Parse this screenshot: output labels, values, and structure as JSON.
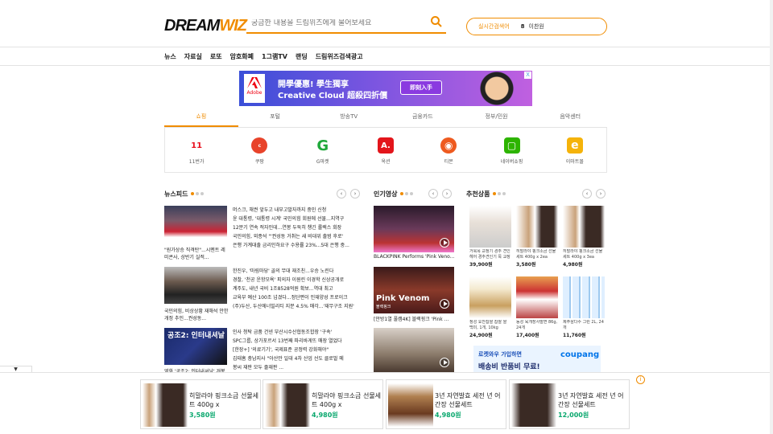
{
  "header": {
    "logo_dream": "DREAM",
    "logo_wiz": "WIZ",
    "search_placeholder": "궁금한 내용을 드림위즈에게 물어보세요",
    "realtime_label": "실시간검색어",
    "realtime_rank": "8",
    "realtime_item": "이찬원"
  },
  "nav": [
    "뉴스",
    "자료실",
    "로또",
    "암호화폐",
    "1그램TV",
    "랜딩",
    "드림위즈검색광고"
  ],
  "banner": {
    "brand": "Adobe",
    "line1": "開學優惠! 學生獨享",
    "line2": "Creative Cloud 超殺四折價",
    "cta": "即刻入手",
    "close": "X"
  },
  "category_tabs": [
    "쇼핑",
    "포털",
    "방송TV",
    "금융카드",
    "정부/민원",
    "음악센터"
  ],
  "shops": [
    {
      "label": "11번가",
      "mark": "11",
      "color": "#ffffff",
      "text": "#e8101e"
    },
    {
      "label": "쿠팡",
      "mark": "c",
      "color": "#e8432a",
      "text": "#ffffff"
    },
    {
      "label": "G마켓",
      "mark": "G",
      "color": "#ffffff",
      "text": "#1fa83a"
    },
    {
      "label": "옥션",
      "mark": "A.",
      "color": "#e3151b",
      "text": "#ffffff"
    },
    {
      "label": "티몬",
      "mark": "◉",
      "color": "#ee5a1f",
      "text": "#ffffff"
    },
    {
      "label": "네이버쇼핑",
      "mark": "▢",
      "color": "#2db400",
      "text": "#ffffff"
    },
    {
      "label": "이마트몰",
      "mark": "e",
      "color": "#f5b30a",
      "text": "#ffffff"
    }
  ],
  "news": {
    "title": "뉴스피드",
    "items": [
      {
        "caption": "\"원가상승 직격탄\"...시멘트 레미콘사, 상반기 실적...",
        "text": [
          "머스크, 채권 앞두고 내부고발자까지 중인 신청",
          "윤 대통령, '대통령 시계' 국민의힘 회원에 선물...지역구",
          "12분기 연속 적자인데...연봉 두둑히 챙긴 롤렉스 회장",
          "국민의힘, 외종석 \"'권성동 거취는 새 비대위 출범 후로'",
          "은행 가계대출 금리인하요구 수용률 23%...5대 은행 중..."
        ]
      },
      {
        "caption": "국민의힘, 비상상황 재해석 안한 개정 추인...권성동...",
        "text": [
          "한진우, '마림마당' 골의 무대 재조친...우승 노린다",
          "경찰, '천공 운항모욕' 피의자 이원린 이경학 신상공개로",
          "계주도, 내년 국비 1조8528억원 확보...역대 최고",
          "교육부 예산 100조 넘겼다...정단편이 인재양성 프로이크",
          "(주)두산, 두산에너빌리티 지분 4.5% 매각...'재무구조 지원'"
        ]
      },
      {
        "caption": "영화 '공조2: 인터내셔날' 개봉 전 무대인사...",
        "text": [
          "인사 청탁 금품 건넨 부산시수산협동조합장 '구속'",
          "SPC그룹, 상가포르서 13번째 파리바게뜨 매장 열었다",
          "[한장+] '의료기기', 국제표준 공정력 강화해야\"",
          "김태흠 충남지사 \"아산만 일대 4차 산업 선도 클로벌 메",
          "봉씨 재판 모두 줄재판 ..."
        ]
      }
    ]
  },
  "videos": {
    "title": "인기영상",
    "items": [
      {
        "caption": "BLACKPINK Performs 'Pink Veno..."
      },
      {
        "caption": "[안방1열 풀캠4K] 블랙핑크 'Pink ...",
        "overlay": "Pink Venom",
        "sub": "블랙핑크"
      },
      {
        "caption": ""
      }
    ]
  },
  "products": {
    "title": "추천상품",
    "items": [
      {
        "name": "거북목 교정기 경추 견인 헤어 경추견인기 목 교정기",
        "price": "39,900원"
      },
      {
        "name": "히말라야 핑크소금 선물세트 400g x 2ea",
        "price": "3,580원"
      },
      {
        "name": "히말라야 핑크소금 선물세트 400g x 3ea",
        "price": "4,980원"
      },
      {
        "name": "정성 요잔찹쌀 찹쌀 쌀 백미, 1개, 10kg",
        "price": "24,900원"
      },
      {
        "name": "동성 육개장사발면 86g, 24개",
        "price": "17,400원"
      },
      {
        "name": "제주삼다수 그린 2L, 24개",
        "price": "11,760원"
      }
    ],
    "coupang_line1": "로켓와우 가입하면",
    "coupang_line2": "배송비 반품비 무료!",
    "coupang_brand": "coupang"
  },
  "bottom_ads": [
    {
      "name": "히말라야 핑크소금 선물세트 400g x",
      "price": "3,580원"
    },
    {
      "name": "히말라야 핑크소금 선물세트 400g x",
      "price": "4,980원"
    },
    {
      "name": "3년 자연발효 세전 년 어간장 선물세트",
      "price": "4,980원"
    },
    {
      "name": "3년 자연발효 세전 년 어간장 선물세트",
      "price": "12,000원"
    }
  ],
  "ui": {
    "prev": "‹",
    "next": "›",
    "collapse": "▼",
    "info": "i"
  },
  "colors": {
    "accent": "#f08c00",
    "price_green": "#0aa86e"
  }
}
